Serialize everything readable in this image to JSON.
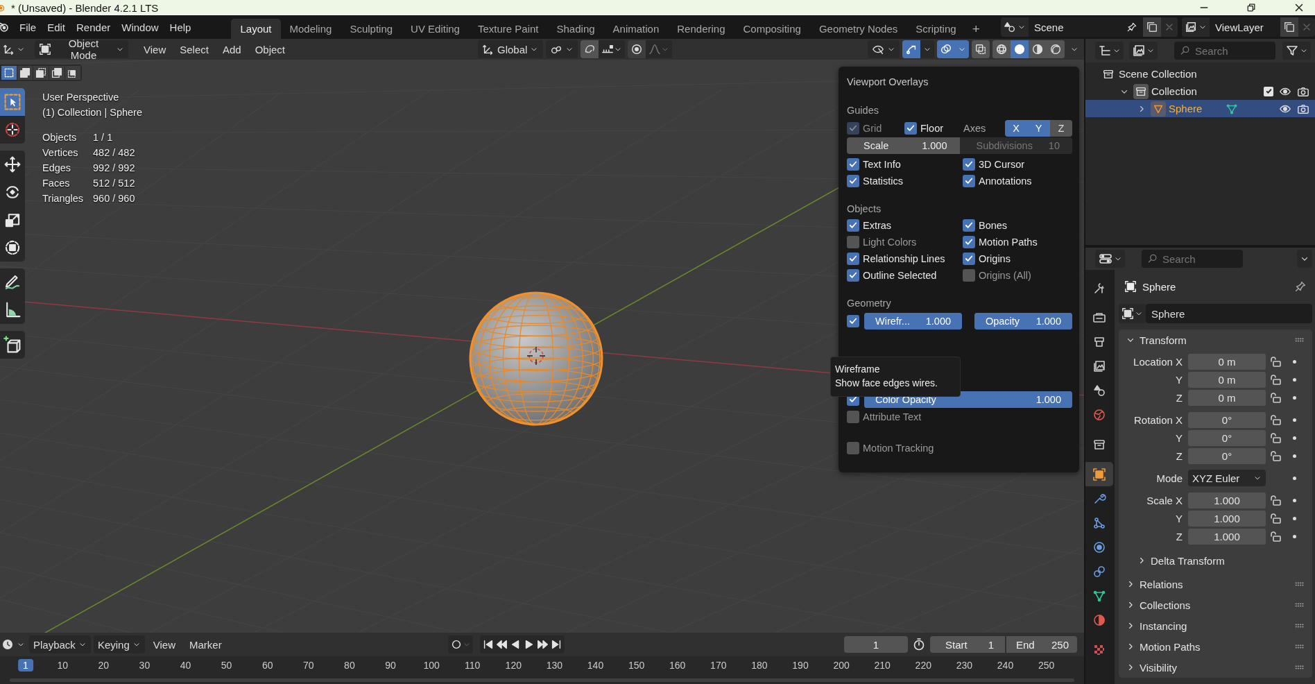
{
  "window": {
    "title": "* (Unsaved) - Blender 4.2.1 LTS"
  },
  "menu": [
    "File",
    "Edit",
    "Render",
    "Window",
    "Help"
  ],
  "workspaces": [
    {
      "label": "Layout",
      "selected": true
    },
    {
      "label": "Modeling",
      "selected": false
    },
    {
      "label": "Sculpting",
      "selected": false
    },
    {
      "label": "UV Editing",
      "selected": false
    },
    {
      "label": "Texture Paint",
      "selected": false
    },
    {
      "label": "Shading",
      "selected": false
    },
    {
      "label": "Animation",
      "selected": false
    },
    {
      "label": "Rendering",
      "selected": false
    },
    {
      "label": "Compositing",
      "selected": false
    },
    {
      "label": "Geometry Nodes",
      "selected": false
    },
    {
      "label": "Scripting",
      "selected": false
    }
  ],
  "add_workspace": "+",
  "scene": {
    "name": "Scene"
  },
  "view_layer": {
    "name": "ViewLayer"
  },
  "viewport_header": {
    "mode": "Object Mode",
    "menus": [
      "View",
      "Select",
      "Add",
      "Object"
    ],
    "orientation": "Global",
    "gizmos": true,
    "overlays": true,
    "shading": [
      {
        "kind": "wireframe",
        "selected": false
      },
      {
        "kind": "solid",
        "selected": true
      },
      {
        "kind": "material",
        "selected": false
      },
      {
        "kind": "rendered",
        "selected": false
      }
    ]
  },
  "select_modes": [
    {
      "kind": "set",
      "selected": true
    },
    {
      "kind": "extend",
      "selected": false
    },
    {
      "kind": "subtract",
      "selected": false
    },
    {
      "kind": "invert",
      "selected": false
    },
    {
      "kind": "intersect",
      "selected": false
    }
  ],
  "tools": [
    {
      "kind": "select",
      "selected": true
    },
    {
      "kind": "cursor",
      "selected": false
    },
    {
      "kind": "move",
      "selected": false
    },
    {
      "kind": "rotate",
      "selected": false
    },
    {
      "kind": "scale",
      "selected": false
    },
    {
      "kind": "transform",
      "selected": false
    },
    {
      "kind": "annotate",
      "selected": false
    },
    {
      "kind": "measure",
      "selected": false
    },
    {
      "kind": "add_cube",
      "selected": false
    }
  ],
  "text_info": [
    "User Perspective",
    "(1) Collection | Sphere"
  ],
  "statistics": [
    {
      "label": "Objects",
      "value": "1 / 1"
    },
    {
      "label": "Vertices",
      "value": "482 / 482"
    },
    {
      "label": "Edges",
      "value": "992 / 992"
    },
    {
      "label": "Faces",
      "value": "512 / 512"
    },
    {
      "label": "Triangles",
      "value": "960 / 960"
    }
  ],
  "overlays": {
    "title": "Viewport Overlays",
    "guides": {
      "heading": "Guides",
      "grid": {
        "label": "Grid",
        "checked": true,
        "disabled": true
      },
      "floor": {
        "label": "Floor",
        "checked": true
      },
      "axes": {
        "label": "Axes",
        "toggles": [
          {
            "label": "X",
            "on": true
          },
          {
            "label": "Y",
            "on": true
          },
          {
            "label": "Z",
            "on": false
          }
        ]
      },
      "scale": {
        "label": "Scale",
        "value": "1.000"
      },
      "subdivisions": {
        "label": "Subdivisions",
        "value": "10",
        "disabled": true
      },
      "options": [
        {
          "label": "Text Info",
          "checked": true
        },
        {
          "label": "3D Cursor",
          "checked": true
        },
        {
          "label": "Statistics",
          "checked": true
        },
        {
          "label": "Annotations",
          "checked": true
        }
      ]
    },
    "objects": {
      "heading": "Objects",
      "options": [
        {
          "label": "Extras",
          "checked": true
        },
        {
          "label": "Bones",
          "checked": true
        },
        {
          "label": "Light Colors",
          "checked": false
        },
        {
          "label": "Motion Paths",
          "checked": true
        },
        {
          "label": "Relationship Lines",
          "checked": true
        },
        {
          "label": "Origins",
          "checked": true
        },
        {
          "label": "Outline Selected",
          "checked": true
        },
        {
          "label": "Origins (All)",
          "checked": false
        }
      ]
    },
    "geometry": {
      "heading": "Geometry",
      "wireframe": {
        "checked": true,
        "label": "Wirefr...",
        "value": "1.000",
        "level": 1
      },
      "opacity": {
        "label": "Opacity",
        "value": "1.000",
        "level": 1
      },
      "color_opacity": {
        "checked": true,
        "label": "Color Opacity",
        "value": "1.000",
        "level": 1
      },
      "attribute_text": {
        "label": "Attribute Text",
        "checked": false
      }
    },
    "motion_tracking": {
      "label": "Motion Tracking",
      "checked": false
    }
  },
  "tooltip": {
    "title": "Wireframe",
    "description": "Show face edges wires."
  },
  "outliner": {
    "search": {
      "placeholder": "Search"
    },
    "tree": [
      {
        "label": "Scene Collection",
        "kind": "scene_collection",
        "selected": false,
        "children": [
          {
            "label": "Collection",
            "kind": "collection",
            "expanded": true,
            "selected": false,
            "checked": true,
            "children": [
              {
                "label": "Sphere",
                "kind": "mesh_object",
                "expanded": false,
                "selected": true
              }
            ]
          }
        ]
      }
    ]
  },
  "properties": {
    "search": {
      "placeholder": "Search"
    },
    "tabs": [
      {
        "kind": "tool",
        "selected": false
      },
      {
        "kind": "render",
        "selected": false
      },
      {
        "kind": "output",
        "selected": false
      },
      {
        "kind": "view_layer",
        "selected": false
      },
      {
        "kind": "scene",
        "selected": false
      },
      {
        "kind": "world",
        "selected": false
      },
      {
        "kind": "collection",
        "selected": false
      },
      {
        "kind": "object",
        "selected": true
      },
      {
        "kind": "modifiers",
        "selected": false
      },
      {
        "kind": "particles",
        "selected": false
      },
      {
        "kind": "physics",
        "selected": false
      },
      {
        "kind": "constraints",
        "selected": false
      },
      {
        "kind": "data",
        "selected": false
      },
      {
        "kind": "material",
        "selected": false
      },
      {
        "kind": "texture",
        "selected": false
      }
    ],
    "object_name": "Sphere",
    "datablock": "Sphere",
    "panels": [
      {
        "label": "Transform",
        "expanded": true,
        "groups": [
          [
            {
              "kind": "number",
              "label": "Location X",
              "value": "0 m"
            },
            {
              "kind": "number",
              "label": "Y",
              "value": "0 m"
            },
            {
              "kind": "number",
              "label": "Z",
              "value": "0 m"
            }
          ],
          [
            {
              "kind": "number",
              "label": "Rotation X",
              "value": "0°"
            },
            {
              "kind": "number",
              "label": "Y",
              "value": "0°"
            },
            {
              "kind": "number",
              "label": "Z",
              "value": "0°"
            }
          ],
          [
            {
              "kind": "dropdown",
              "label": "Mode",
              "value": "XYZ Euler"
            }
          ],
          [
            {
              "kind": "number",
              "label": "Scale X",
              "value": "1.000"
            },
            {
              "kind": "number",
              "label": "Y",
              "value": "1.000"
            },
            {
              "kind": "number",
              "label": "Z",
              "value": "1.000"
            }
          ]
        ],
        "subpanels": [
          {
            "label": "Delta Transform",
            "expanded": false
          }
        ]
      },
      {
        "label": "Relations",
        "expanded": false
      },
      {
        "label": "Collections",
        "expanded": false
      },
      {
        "label": "Instancing",
        "expanded": false
      },
      {
        "label": "Motion Paths",
        "expanded": false
      },
      {
        "label": "Visibility",
        "expanded": false
      }
    ]
  },
  "timeline": {
    "menus": [
      "Playback",
      "Keying",
      "View",
      "Marker"
    ],
    "current_frame": "1",
    "start": {
      "label": "Start",
      "value": "1"
    },
    "end": {
      "label": "End",
      "value": "250"
    },
    "ruler": [
      {
        "label": "1",
        "selected": true
      },
      {
        "label": "10",
        "selected": false
      },
      {
        "label": "20",
        "selected": false
      },
      {
        "label": "30",
        "selected": false
      },
      {
        "label": "40",
        "selected": false
      },
      {
        "label": "50",
        "selected": false
      },
      {
        "label": "60",
        "selected": false
      },
      {
        "label": "70",
        "selected": false
      },
      {
        "label": "80",
        "selected": false
      },
      {
        "label": "90",
        "selected": false
      },
      {
        "label": "100",
        "selected": false
      },
      {
        "label": "110",
        "selected": false
      },
      {
        "label": "120",
        "selected": false
      },
      {
        "label": "130",
        "selected": false
      },
      {
        "label": "140",
        "selected": false
      },
      {
        "label": "150",
        "selected": false
      },
      {
        "label": "160",
        "selected": false
      },
      {
        "label": "170",
        "selected": false
      },
      {
        "label": "180",
        "selected": false
      },
      {
        "label": "190",
        "selected": false
      },
      {
        "label": "200",
        "selected": false
      },
      {
        "label": "210",
        "selected": false
      },
      {
        "label": "220",
        "selected": false
      },
      {
        "label": "230",
        "selected": false
      },
      {
        "label": "240",
        "selected": false
      },
      {
        "label": "250",
        "selected": false
      }
    ]
  }
}
